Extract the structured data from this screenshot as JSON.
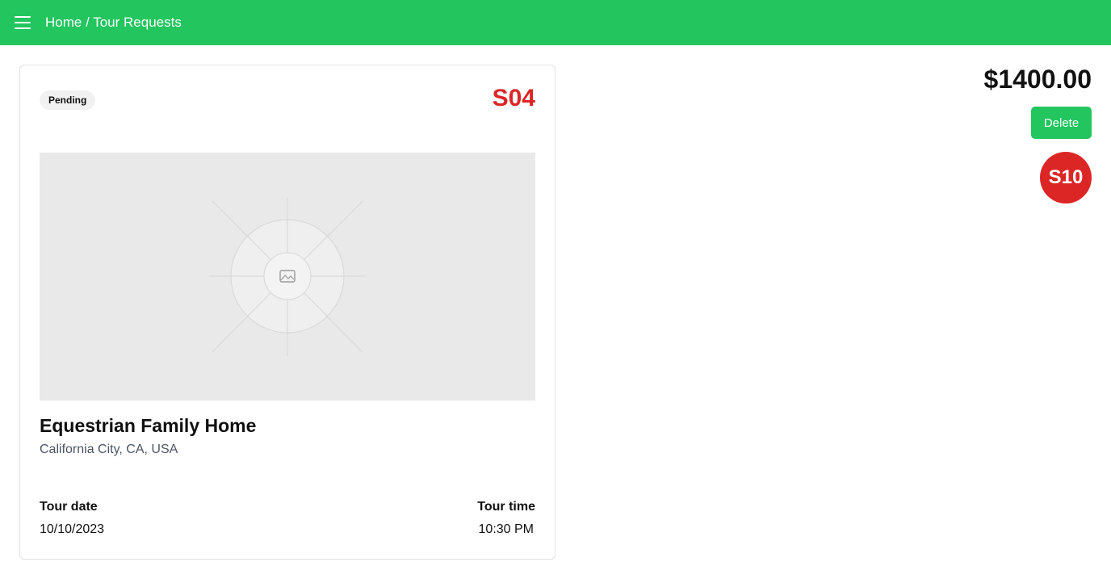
{
  "header": {
    "breadcrumb": "Home / Tour Requests",
    "menu_icon": "hamburger-icon"
  },
  "card": {
    "status": "Pending",
    "code": "S04",
    "title": "Equestrian Family Home",
    "location": "California City, CA, USA",
    "tour_date_label": "Tour date",
    "tour_date": "10/10/2023",
    "tour_time_label": "Tour time",
    "tour_time": "10:30 PM",
    "image_icon": "image-placeholder-icon"
  },
  "side": {
    "price": "$1400.00",
    "delete_label": "Delete",
    "avatar": "S10"
  },
  "colors": {
    "brand": "#22c55e",
    "accent_red": "#dc2626"
  }
}
